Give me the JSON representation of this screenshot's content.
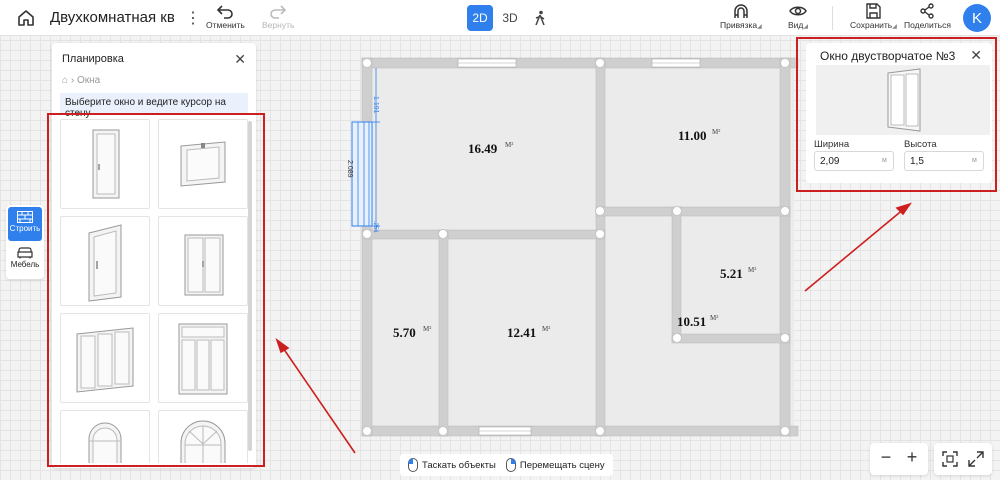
{
  "header": {
    "project_title": "Двухкомнатная квар",
    "undo_label": "Отменить",
    "redo_label": "Вернуть",
    "view_2d": "2D",
    "view_3d": "3D",
    "snap_label": "Привязка",
    "view_label": "Вид",
    "save_label": "Сохранить",
    "share_label": "Поделиться",
    "avatar_initial": "K"
  },
  "left_panel": {
    "title": "Планировка",
    "breadcrumb": "Окна",
    "hint": "Выберите окно и ведите курсор на стену",
    "window_items": [
      {
        "icon": "single-casement-window-icon"
      },
      {
        "icon": "awning-window-icon"
      },
      {
        "icon": "single-tall-window-icon"
      },
      {
        "icon": "double-casement-window-icon"
      },
      {
        "icon": "triple-window-icon"
      },
      {
        "icon": "triple-window-transom-icon"
      },
      {
        "icon": "arched-window-icon"
      },
      {
        "icon": "arched-double-window-icon"
      }
    ]
  },
  "tool_rail": {
    "build_label": "Строить",
    "furniture_label": "Мебель"
  },
  "plan": {
    "rooms": [
      {
        "area": "16.49",
        "unit": "M²"
      },
      {
        "area": "11.00",
        "unit": "M²"
      },
      {
        "area": "5.21",
        "unit": "M²"
      },
      {
        "area": "5.70",
        "unit": "M²"
      },
      {
        "area": "12.41",
        "unit": "M²"
      },
      {
        "area": "10.51",
        "unit": "M²"
      }
    ],
    "dimensions": {
      "top": "1.191",
      "mid": "2.089",
      "bottom": ".251"
    }
  },
  "right_panel": {
    "title": "Окно двустворчатое №3",
    "width_label": "Ширина",
    "width_value": "2,09",
    "width_unit": "м",
    "height_label": "Высота",
    "height_value": "1,5",
    "height_unit": "м"
  },
  "bottom_hints": {
    "drag_objects": "Таскать объекты",
    "move_scene": "Перемещать сцену"
  },
  "zoom": {
    "minus": "−",
    "plus": "+"
  },
  "colors": {
    "accent": "#2f80ed",
    "annotation_red": "#cc1f1f",
    "wall": "#cfcfcf",
    "room_fill": "#ebebeb"
  }
}
